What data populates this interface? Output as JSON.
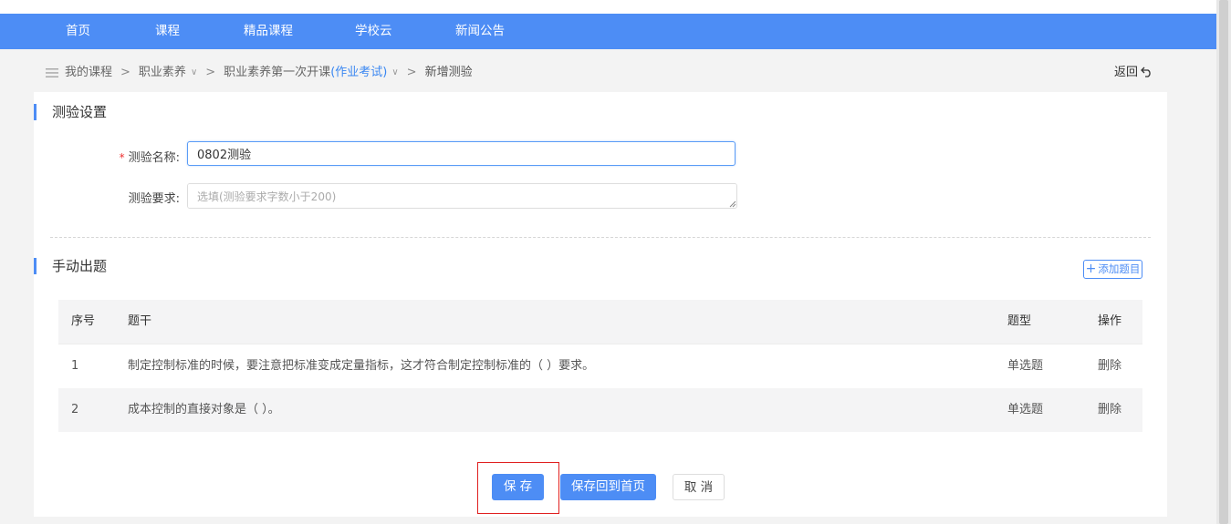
{
  "nav": {
    "items": [
      "首页",
      "课程",
      "精品课程",
      "学校云",
      "新闻公告"
    ]
  },
  "breadcrumb": {
    "items": [
      "我的课程",
      "职业素养",
      "职业素养第一次开课"
    ],
    "tag": "(作业考试)",
    "current": "新增测验",
    "back_label": "返回"
  },
  "settings": {
    "title": "测验设置",
    "name_label": "测验名称:",
    "name_value": "0802测验",
    "requirement_label": "测验要求:",
    "requirement_placeholder": "选填(测验要求字数小于200)"
  },
  "questions": {
    "title": "手动出题",
    "add_label": "添加题目",
    "headers": {
      "no": "序号",
      "stem": "题干",
      "type": "题型",
      "op": "操作"
    },
    "rows": [
      {
        "no": "1",
        "stem": "制定控制标准的时候，要注意把标准变成定量指标，这才符合制定控制标准的（ ）要求。",
        "type": "单选题",
        "op": "删除"
      },
      {
        "no": "2",
        "stem": "成本控制的直接对象是（ ）。",
        "type": "单选题",
        "op": "删除"
      }
    ]
  },
  "actions": {
    "save": "保 存",
    "save_home": "保存回到首页",
    "cancel": "取 消"
  },
  "colors": {
    "primary": "#4d8df5",
    "link": "#3a87f2",
    "highlight": "#e02020",
    "required": "#ee3333"
  }
}
